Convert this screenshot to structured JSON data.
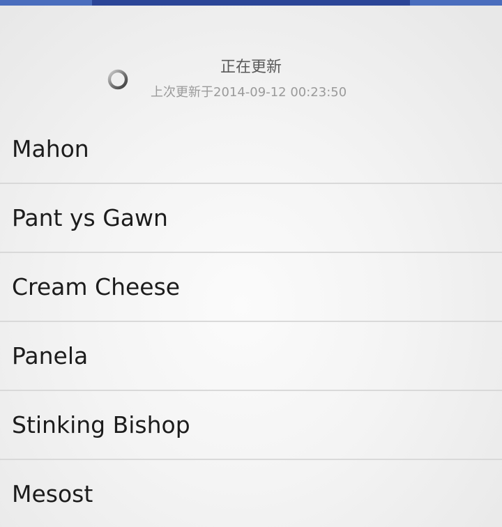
{
  "status_bar": {
    "accent_color": "#2b4597",
    "base_color": "#4a6dbd"
  },
  "refresh_header": {
    "spinner_icon": "loading-spinner-icon",
    "title": "正在更新",
    "last_updated": "上次更新于2014-09-12 00:23:50"
  },
  "list": {
    "items": [
      {
        "label": "Mahon"
      },
      {
        "label": "Pant ys Gawn"
      },
      {
        "label": "Cream Cheese"
      },
      {
        "label": "Panela"
      },
      {
        "label": "Stinking Bishop"
      },
      {
        "label": "Mesost"
      }
    ]
  }
}
